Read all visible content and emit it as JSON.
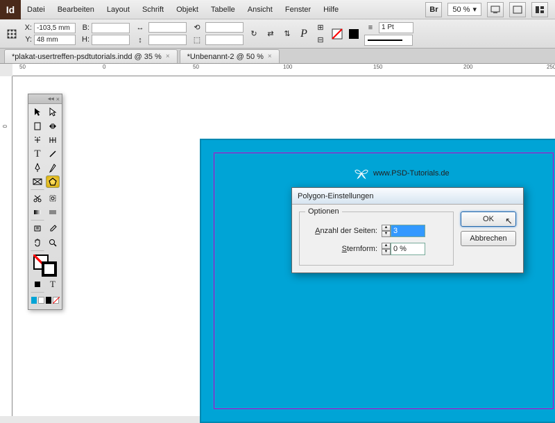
{
  "menubar": {
    "items": [
      "Datei",
      "Bearbeiten",
      "Layout",
      "Schrift",
      "Objekt",
      "Tabelle",
      "Ansicht",
      "Fenster",
      "Hilfe"
    ],
    "br_label": "Br",
    "zoom": "50 %"
  },
  "control": {
    "x_label": "X:",
    "x_val": "-103,5 mm",
    "y_label": "Y:",
    "y_val": "48 mm",
    "b_label": "B:",
    "h_label": "H:",
    "stroke_weight": "1 Pt"
  },
  "tabs": [
    {
      "label": "*plakat-usertreffen-psdtutorials.indd @ 35 %"
    },
    {
      "label": "*Unbenannt-2 @ 50 %"
    }
  ],
  "ruler_h": [
    "50",
    "0",
    "50",
    "100",
    "150",
    "200",
    "250"
  ],
  "ruler_v": [
    "0"
  ],
  "page": {
    "url": "www.PSD-Tutorials.de"
  },
  "dialog": {
    "title": "Polygon-Einstellungen",
    "legend": "Optionen",
    "sides_label_pre": "",
    "sides_label_u": "A",
    "sides_label_post": "nzahl der Seiten:",
    "sides_value": "3",
    "star_label_pre": "",
    "star_label_u": "S",
    "star_label_post": "ternform:",
    "star_value": "0 %",
    "ok": "OK",
    "cancel": "Abbrechen"
  },
  "tools": {
    "swatches": [
      "#00a4d6",
      "#ffffff",
      "#000000"
    ]
  }
}
